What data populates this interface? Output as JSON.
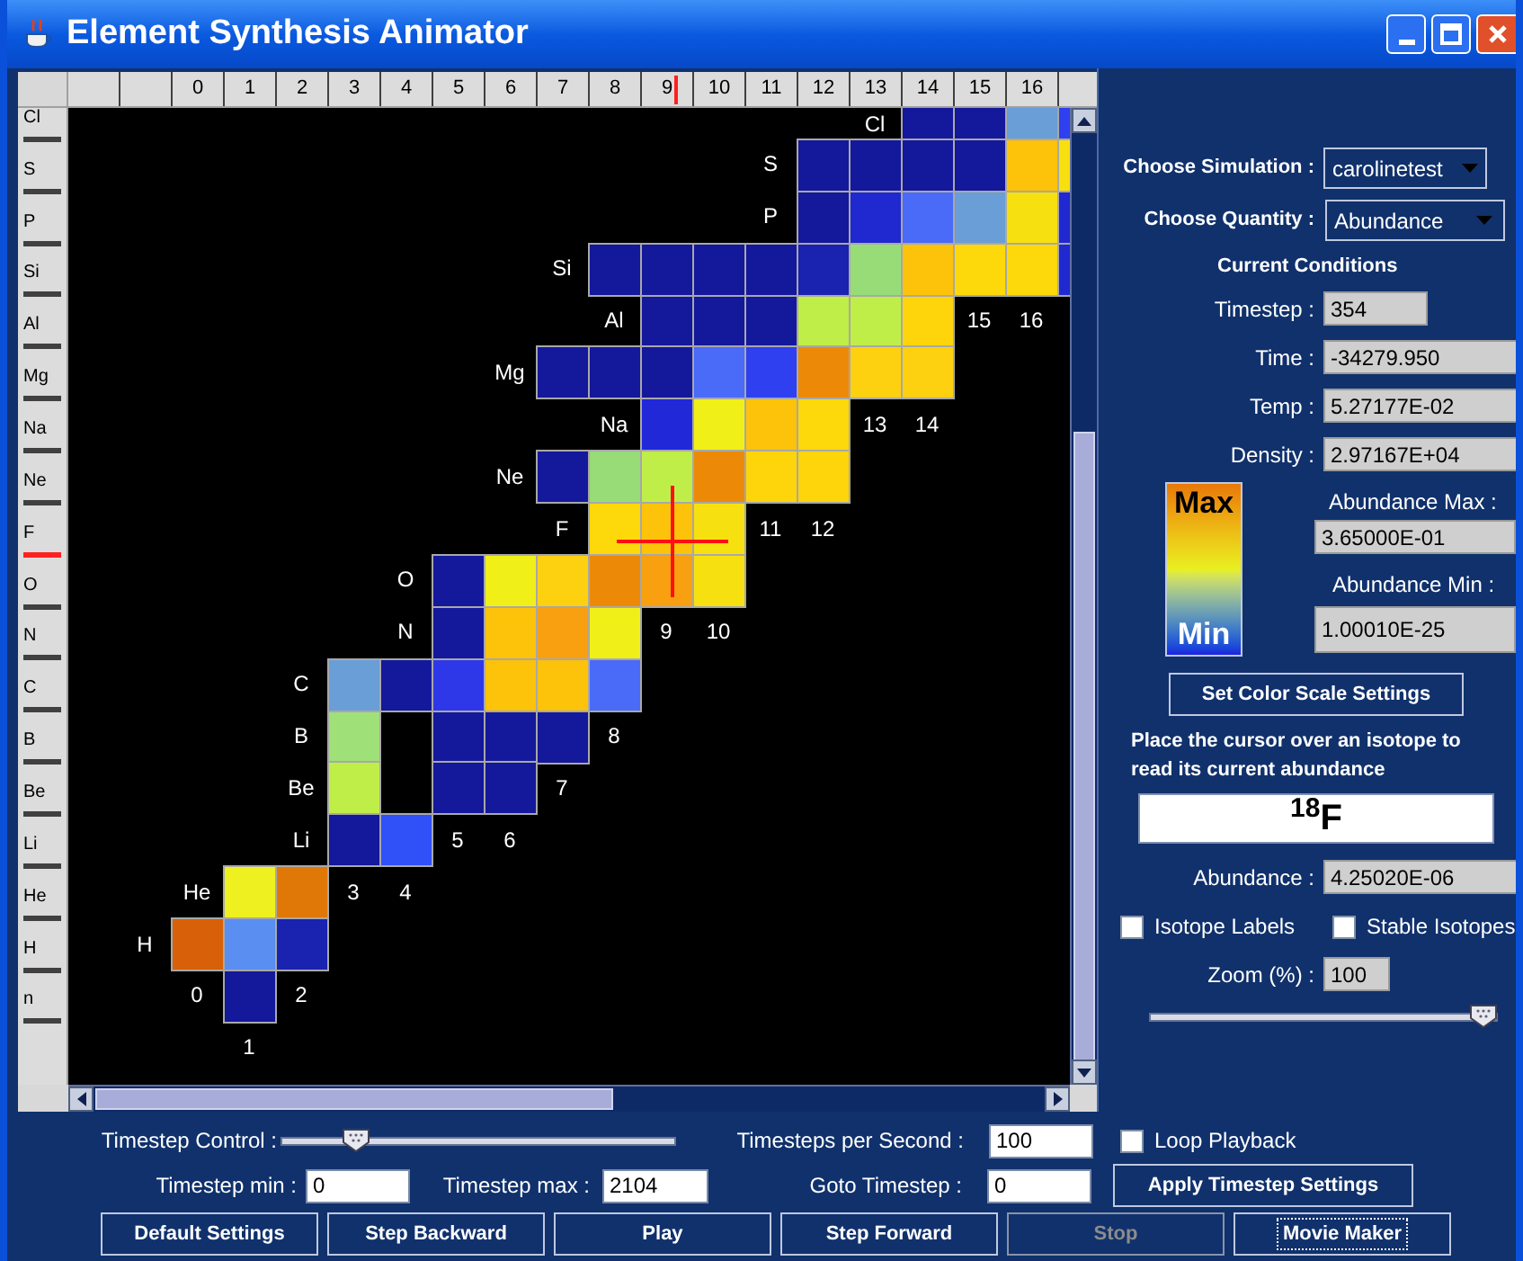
{
  "window": {
    "title": "Element Synthesis Animator"
  },
  "chart": {
    "top_ruler": [
      {
        "label": "0",
        "selected": false
      },
      {
        "label": "1",
        "selected": false
      },
      {
        "label": "2",
        "selected": false
      },
      {
        "label": "3",
        "selected": false
      },
      {
        "label": "4",
        "selected": false
      },
      {
        "label": "5",
        "selected": false
      },
      {
        "label": "6",
        "selected": false
      },
      {
        "label": "7",
        "selected": false
      },
      {
        "label": "8",
        "selected": false
      },
      {
        "label": "9",
        "selected": true
      },
      {
        "label": "10",
        "selected": false
      },
      {
        "label": "11",
        "selected": false
      },
      {
        "label": "12",
        "selected": false
      },
      {
        "label": "13",
        "selected": false
      },
      {
        "label": "14",
        "selected": false
      },
      {
        "label": "15",
        "selected": false
      },
      {
        "label": "16",
        "selected": false
      }
    ],
    "side_ruler": [
      {
        "label": "Cl",
        "selected": false
      },
      {
        "label": "S",
        "selected": false
      },
      {
        "label": "P",
        "selected": false
      },
      {
        "label": "Si",
        "selected": false
      },
      {
        "label": "Al",
        "selected": false
      },
      {
        "label": "Mg",
        "selected": false
      },
      {
        "label": "Na",
        "selected": false
      },
      {
        "label": "Ne",
        "selected": false
      },
      {
        "label": "F",
        "selected": true
      },
      {
        "label": "O",
        "selected": false
      },
      {
        "label": "N",
        "selected": false
      },
      {
        "label": "C",
        "selected": false
      },
      {
        "label": "B",
        "selected": false
      },
      {
        "label": "Be",
        "selected": false
      },
      {
        "label": "Li",
        "selected": false
      },
      {
        "label": "He",
        "selected": false
      },
      {
        "label": "H",
        "selected": false
      },
      {
        "label": "n",
        "selected": false
      }
    ],
    "rows": [
      {
        "items": [
          {
            "kind": "symbol",
            "text": "Cl"
          },
          {
            "kind": "isotope",
            "color": "#14189a"
          },
          {
            "kind": "isotope",
            "color": "#14189a"
          },
          {
            "kind": "isotope",
            "color": "#6a9ed6"
          },
          {
            "kind": "isotope",
            "color": "#2f40f0"
          }
        ]
      },
      {
        "items": [
          {
            "kind": "symbol",
            "text": "S"
          },
          {
            "kind": "isotope",
            "color": "#14189a"
          },
          {
            "kind": "isotope",
            "color": "#14189a"
          },
          {
            "kind": "isotope",
            "color": "#14189a"
          },
          {
            "kind": "isotope",
            "color": "#14189a"
          },
          {
            "kind": "isotope",
            "color": "#fdc20a"
          },
          {
            "kind": "isotope",
            "color": "#f7e010"
          }
        ]
      },
      {
        "items": [
          {
            "kind": "symbol",
            "text": "P"
          },
          {
            "kind": "isotope",
            "color": "#14189a"
          },
          {
            "kind": "isotope",
            "color": "#2028d0"
          },
          {
            "kind": "isotope",
            "color": "#4a6af8"
          },
          {
            "kind": "isotope",
            "color": "#6a9ed6"
          },
          {
            "kind": "isotope",
            "color": "#f7e010"
          },
          {
            "kind": "isotope",
            "color": "#2028d0"
          }
        ]
      },
      {
        "items": [
          {
            "kind": "symbol",
            "text": "Si"
          },
          {
            "kind": "isotope",
            "color": "#14189a"
          },
          {
            "kind": "isotope",
            "color": "#14189a"
          },
          {
            "kind": "isotope",
            "color": "#14189a"
          },
          {
            "kind": "isotope",
            "color": "#14189a"
          },
          {
            "kind": "isotope",
            "color": "#1a22b0"
          },
          {
            "kind": "isotope",
            "color": "#98dc78"
          },
          {
            "kind": "isotope",
            "color": "#fdc20a"
          },
          {
            "kind": "isotope",
            "color": "#fdd80a"
          },
          {
            "kind": "isotope",
            "color": "#fdd80a"
          },
          {
            "kind": "isotope",
            "color": "#2028d0"
          }
        ]
      },
      {
        "items": [
          {
            "kind": "symbol",
            "text": "Al"
          },
          {
            "kind": "isotope",
            "color": "#14189a"
          },
          {
            "kind": "isotope",
            "color": "#14189a"
          },
          {
            "kind": "isotope",
            "color": "#14189a"
          },
          {
            "kind": "isotope",
            "color": "#c0ee48"
          },
          {
            "kind": "isotope",
            "color": "#c0ee48"
          },
          {
            "kind": "isotope",
            "color": "#fdd50a"
          },
          {
            "kind": "number",
            "text": "15"
          },
          {
            "kind": "number",
            "text": "16"
          }
        ]
      },
      {
        "items": [
          {
            "kind": "symbol",
            "text": "Mg"
          },
          {
            "kind": "isotope",
            "color": "#14189a"
          },
          {
            "kind": "isotope",
            "color": "#14189a"
          },
          {
            "kind": "isotope",
            "color": "#14189a"
          },
          {
            "kind": "isotope",
            "color": "#4a6af8"
          },
          {
            "kind": "isotope",
            "color": "#2f40f0"
          },
          {
            "kind": "isotope",
            "color": "#ec8a08"
          },
          {
            "kind": "isotope",
            "color": "#fdd010"
          },
          {
            "kind": "isotope",
            "color": "#fdd010"
          }
        ]
      },
      {
        "items": [
          {
            "kind": "symbol",
            "text": "Na"
          },
          {
            "kind": "isotope",
            "color": "#2028d8"
          },
          {
            "kind": "isotope",
            "color": "#f0f018"
          },
          {
            "kind": "isotope",
            "color": "#fdc20a"
          },
          {
            "kind": "isotope",
            "color": "#fdd80a"
          },
          {
            "kind": "number",
            "text": "13"
          },
          {
            "kind": "number",
            "text": "14"
          }
        ]
      },
      {
        "items": [
          {
            "kind": "symbol",
            "text": "Ne"
          },
          {
            "kind": "isotope",
            "color": "#14189a"
          },
          {
            "kind": "isotope",
            "color": "#98dc78"
          },
          {
            "kind": "isotope",
            "color": "#c0ee48"
          },
          {
            "kind": "isotope",
            "color": "#ec8a08"
          },
          {
            "kind": "isotope",
            "color": "#fdd50a"
          },
          {
            "kind": "isotope",
            "color": "#fdd50a"
          }
        ]
      },
      {
        "items": [
          {
            "kind": "symbol",
            "text": "F"
          },
          {
            "kind": "isotope",
            "color": "#fdd80a"
          },
          {
            "kind": "isotope",
            "color": "#fdc20a"
          },
          {
            "kind": "isotope",
            "color": "#f7e010"
          },
          {
            "kind": "number",
            "text": "11"
          },
          {
            "kind": "number",
            "text": "12"
          }
        ]
      },
      {
        "items": [
          {
            "kind": "symbol",
            "text": "O"
          },
          {
            "kind": "isotope",
            "color": "#14189a"
          },
          {
            "kind": "isotope",
            "color": "#f0f018"
          },
          {
            "kind": "isotope",
            "color": "#fdd010"
          },
          {
            "kind": "isotope",
            "color": "#ec8a08"
          },
          {
            "kind": "isotope",
            "color": "#f8a010"
          },
          {
            "kind": "isotope",
            "color": "#f7e010"
          }
        ]
      },
      {
        "items": [
          {
            "kind": "symbol",
            "text": "N"
          },
          {
            "kind": "isotope",
            "color": "#14189a"
          },
          {
            "kind": "isotope",
            "color": "#fdc20a"
          },
          {
            "kind": "isotope",
            "color": "#f8a010"
          },
          {
            "kind": "isotope",
            "color": "#f0f018"
          },
          {
            "kind": "number",
            "text": "9"
          },
          {
            "kind": "number",
            "text": "10"
          }
        ]
      },
      {
        "items": [
          {
            "kind": "symbol",
            "text": "C"
          },
          {
            "kind": "isotope",
            "color": "#6a9ed6"
          },
          {
            "kind": "isotope",
            "color": "#14189a"
          },
          {
            "kind": "isotope",
            "color": "#2f38e8"
          },
          {
            "kind": "isotope",
            "color": "#fdc20a"
          },
          {
            "kind": "isotope",
            "color": "#fdc20a"
          },
          {
            "kind": "isotope",
            "color": "#4a6af8"
          }
        ]
      },
      {
        "items": [
          {
            "kind": "symbol",
            "text": "B"
          },
          {
            "kind": "isotope",
            "color": "#a0e078"
          },
          {
            "kind": "isotope",
            "color": "#14189a"
          },
          {
            "kind": "isotope",
            "color": "#14189a"
          },
          {
            "kind": "isotope",
            "color": "#14189a"
          },
          {
            "kind": "number",
            "text": "8"
          }
        ]
      },
      {
        "items": [
          {
            "kind": "symbol",
            "text": "Be"
          },
          {
            "kind": "isotope",
            "color": "#c0ee48"
          },
          {
            "kind": "isotope",
            "color": "#14189a"
          },
          {
            "kind": "isotope",
            "color": "#14189a"
          },
          {
            "kind": "number",
            "text": "7"
          }
        ]
      },
      {
        "items": [
          {
            "kind": "symbol",
            "text": "Li"
          },
          {
            "kind": "isotope",
            "color": "#14189a"
          },
          {
            "kind": "isotope",
            "color": "#3050f8"
          },
          {
            "kind": "number",
            "text": "5"
          },
          {
            "kind": "number",
            "text": "6"
          }
        ]
      },
      {
        "items": [
          {
            "kind": "symbol",
            "text": "He"
          },
          {
            "kind": "isotope",
            "color": "#eef020"
          },
          {
            "kind": "isotope",
            "color": "#e07808"
          },
          {
            "kind": "number",
            "text": "3"
          },
          {
            "kind": "number",
            "text": "4"
          }
        ]
      },
      {
        "items": [
          {
            "kind": "symbol",
            "text": "H"
          },
          {
            "kind": "isotope",
            "color": "#d86008"
          },
          {
            "kind": "isotope",
            "color": "#5a8ef0"
          },
          {
            "kind": "isotope",
            "color": "#1a22b0"
          }
        ]
      },
      {
        "items": [
          {
            "kind": "number",
            "text": "0"
          },
          {
            "kind": "isotope",
            "color": "#14189a"
          },
          {
            "kind": "number",
            "text": "2"
          }
        ]
      },
      {
        "items": [
          {
            "kind": "number",
            "text": "1"
          }
        ]
      }
    ]
  },
  "panel": {
    "simulation": {
      "label": "Choose Simulation :",
      "value": "carolinetest"
    },
    "quantity": {
      "label": "Choose Quantity :",
      "value": "Abundance"
    },
    "conditions_title": "Current Conditions",
    "conditions": [
      {
        "label": "Timestep :",
        "value": "354",
        "kind": "short"
      },
      {
        "label": "Time :",
        "value": "-34279.950",
        "kind": "long"
      },
      {
        "label": "Temp :",
        "value": "5.27177E-02",
        "kind": "long"
      },
      {
        "label": "Density :",
        "value": "2.97167E+04",
        "kind": "long"
      }
    ],
    "scale": {
      "max_text": "Max",
      "min_text": "Min",
      "max_label": "Abundance Max :",
      "max_value": "3.65000E-01",
      "min_label": "Abundance Min :",
      "min_value": "1.00010E-25"
    },
    "scale_button": "Set Color Scale Settings",
    "hint": "Place the cursor over an isotope to read its current abundance",
    "isotope": "$^{18}$F",
    "abundance": {
      "label": "Abundance :",
      "value": "4.25020E-06"
    },
    "checkboxes": [
      {
        "label": "Isotope Labels",
        "checked": false
      },
      {
        "label": "Stable Isotopes",
        "checked": false
      }
    ],
    "zoom": {
      "label": "Zoom (%) :",
      "value": "100",
      "level": 1
    }
  },
  "controls": {
    "timestep_control": {
      "label": "Timestep Control :",
      "level": 0.168
    },
    "rate": {
      "label": "Timesteps per Second :",
      "value": "100"
    },
    "loop": {
      "label": "Loop Playback",
      "checked": false
    },
    "min": {
      "label": "Timestep min :",
      "value": "0"
    },
    "max": {
      "label": "Timestep max :",
      "value": "2104"
    },
    "goto": {
      "label": "Goto Timestep :",
      "value": "0"
    },
    "apply_button": "Apply Timestep Settings",
    "buttons": [
      {
        "label": "Default Settings",
        "disabled": false,
        "focused": false
      },
      {
        "label": "Step Backward",
        "disabled": false,
        "focused": false
      },
      {
        "label": "Play",
        "disabled": false,
        "focused": false
      },
      {
        "label": "Step Forward",
        "disabled": false,
        "focused": false
      },
      {
        "label": "Stop",
        "disabled": true,
        "focused": false
      },
      {
        "label": "Movie Maker",
        "disabled": false,
        "focused": true
      }
    ]
  }
}
